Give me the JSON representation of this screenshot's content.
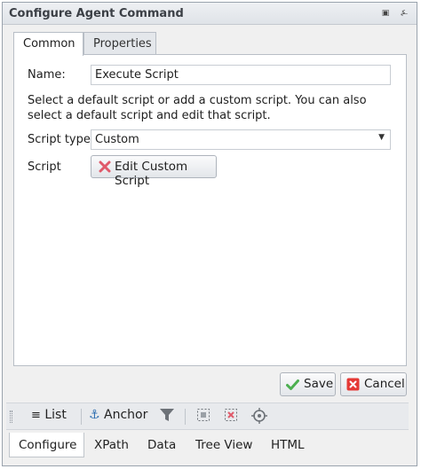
{
  "window": {
    "title": "Configure Agent Command",
    "pin_icon": "pin-icon",
    "menu_icon": "window-menu-icon"
  },
  "tabs": [
    {
      "label": "Common",
      "active": true
    },
    {
      "label": "Properties",
      "active": false
    }
  ],
  "form": {
    "name_label": "Name:",
    "name_value": "Execute Script",
    "description": "Select a default script or add a custom script. You can also select a default script and edit that script.",
    "script_type_label": "Script type",
    "script_type_value": "Custom",
    "script_label": "Script",
    "edit_button_label": "Edit Custom Script"
  },
  "actions": {
    "save_label": "Save",
    "cancel_label": "Cancel"
  },
  "toolbar": {
    "list_label": "List",
    "anchor_label": "Anchor"
  },
  "bottom_tabs": [
    {
      "label": "Configure",
      "active": true
    },
    {
      "label": "XPath",
      "active": false
    },
    {
      "label": "Data",
      "active": false
    },
    {
      "label": "Tree View",
      "active": false
    },
    {
      "label": "HTML",
      "active": false
    }
  ],
  "colors": {
    "save_check": "#4caf50",
    "cancel_red": "#e53935",
    "edit_x": "#e05a6a"
  }
}
